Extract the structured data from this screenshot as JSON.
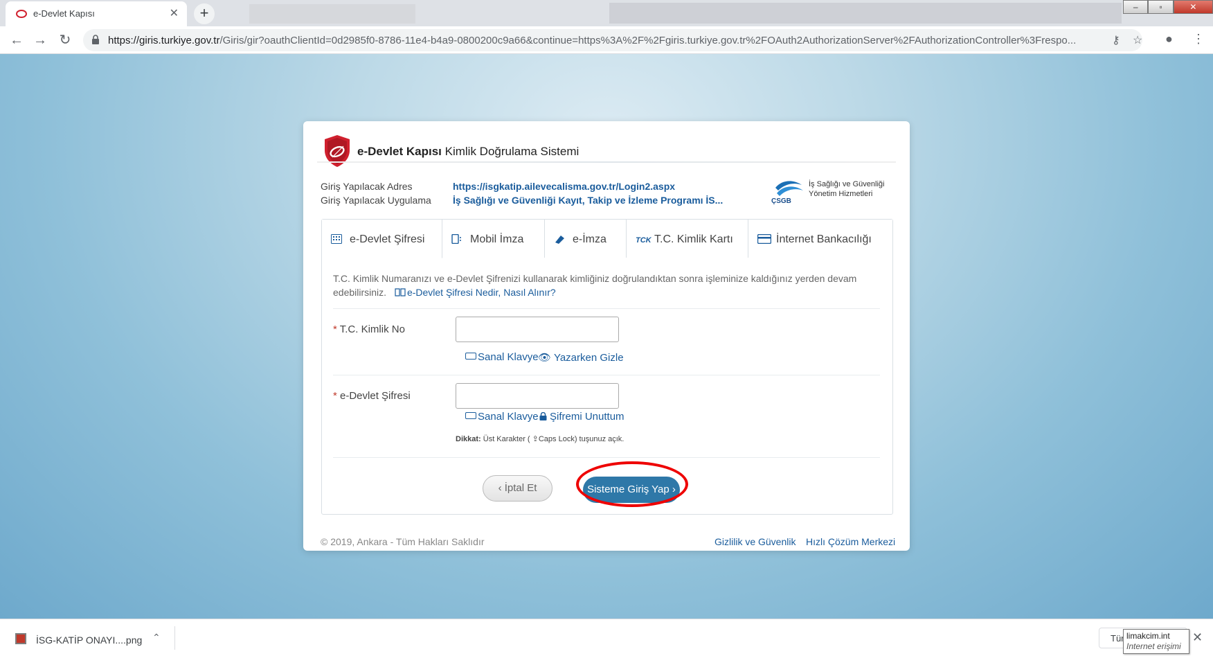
{
  "browser": {
    "tab_title": "e-Devlet Kapısı",
    "tab_close": "✕",
    "new_tab": "+",
    "url_host": "https://giris.turkiye.gov.tr",
    "url_path": "/Giris/gir?oauthClientId=0d2985f0-8786-11e4-b4a9-0800200c9a66&continue=https%3A%2F%2Fgiris.turkiye.gov.tr%2FOAuth2AuthorizationServer%2FAuthorizationController%3Frespo...",
    "back": "←",
    "forward": "→",
    "reload": "↻",
    "key": "⚷",
    "star": "☆",
    "account": "●",
    "menu": "⋮"
  },
  "header": {
    "brand_bold": "e-Devlet Kapısı",
    "brand_rest": " Kimlik Doğrulama Sistemi"
  },
  "info": {
    "address_label": "Giriş Yapılacak Adres",
    "address_value": "https://isgkatip.ailevecalisma.gov.tr/Login2.aspx",
    "app_label": "Giriş Yapılacak Uygulama",
    "app_value": "İş Sağlığı ve Güvenliği Kayıt, Takip ve İzleme Programı İS...",
    "org_line1": "İş Sağlığı ve Güvenliği",
    "org_line2": "Yönetim Hizmetleri",
    "org_abbr": "ÇSGB"
  },
  "tabs": [
    {
      "label": "e-Devlet Şifresi",
      "icon": "keypad-icon"
    },
    {
      "label": "Mobil İmza",
      "icon": "mobile-icon"
    },
    {
      "label": "e-İmza",
      "icon": "usb-token-icon"
    },
    {
      "label": "T.C. Kimlik Kartı",
      "icon": "id-card-icon"
    },
    {
      "label": "İnternet Bankacılığı",
      "icon": "credit-card-icon"
    }
  ],
  "form": {
    "description": "T.C. Kimlik Numaranızı ve e-Devlet Şifrenizi kullanarak kimliğiniz doğrulandıktan sonra işleminize kaldığınız yerden devam edebilirsiniz.",
    "help_link": "e-Devlet Şifresi Nedir, Nasıl Alınır?",
    "req_mark": "*",
    "tc_label": "T.C. Kimlik No",
    "tc_value": "",
    "keyboard_1": "Sanal Klavye",
    "hide_typing": "Yazarken Gizle",
    "pw_label": "e-Devlet Şifresi",
    "pw_value": "",
    "keyboard_2": "Sanal Klavye",
    "forgot": "Şifremi Unuttum",
    "caps_bold": "Dikkat:",
    "caps_text": " Üst Karakter ( ⇪Caps Lock) tuşunuz açık.",
    "cancel_label": "İptal Et",
    "login_label": "Sisteme Giriş Yap",
    "cancel_chevron": "‹",
    "login_chevron": "›"
  },
  "footer": {
    "copyright": "© 2019, Ankara - Tüm Hakları Saklıdır",
    "privacy": "Gizlilik ve Güvenlik",
    "support": "Hızlı Çözüm Merkezi"
  },
  "downloads": {
    "file_name": "İSG-KATİP ONAYI....png",
    "chevron": "⌃",
    "button_label": "Tür",
    "tooltip_line1": "limakcim.int",
    "tooltip_line2": "Internet erişimi",
    "close": "✕"
  },
  "colors": {
    "accent": "#2e78a8",
    "link": "#1a5c9c",
    "highlight_ring": "#e00000",
    "logo_red": "#d0202e"
  }
}
